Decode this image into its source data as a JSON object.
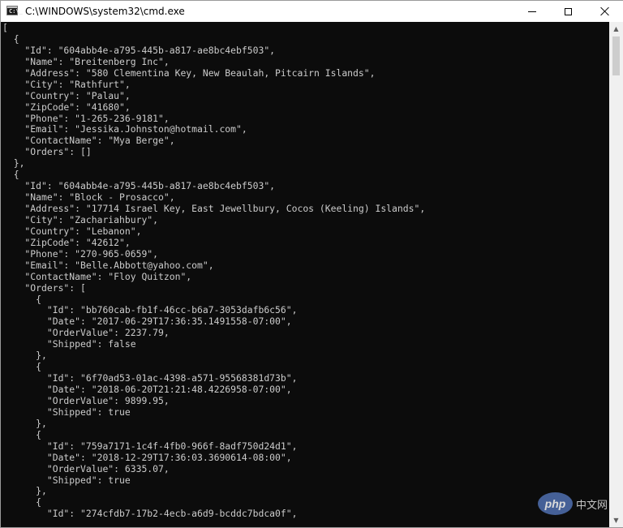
{
  "window": {
    "title": "C:\\WINDOWS\\system32\\cmd.exe",
    "app_icon": "console-icon",
    "controls": {
      "minimize_icon": "minimize-icon",
      "maximize_icon": "maximize-icon",
      "close_icon": "close-icon"
    }
  },
  "console": {
    "background": "#0c0c0c",
    "foreground": "#cccccc",
    "text": "[\n  {\n    \"Id\": \"604abb4e-a795-445b-a817-ae8bc4ebf503\",\n    \"Name\": \"Breitenberg Inc\",\n    \"Address\": \"580 Clementina Key, New Beaulah, Pitcairn Islands\",\n    \"City\": \"Rathfurt\",\n    \"Country\": \"Palau\",\n    \"ZipCode\": \"41680\",\n    \"Phone\": \"1-265-236-9181\",\n    \"Email\": \"Jessika.Johnston@hotmail.com\",\n    \"ContactName\": \"Mya Berge\",\n    \"Orders\": []\n  },\n  {\n    \"Id\": \"604abb4e-a795-445b-a817-ae8bc4ebf503\",\n    \"Name\": \"Block - Prosacco\",\n    \"Address\": \"17714 Israel Key, East Jewellbury, Cocos (Keeling) Islands\",\n    \"City\": \"Zachariahbury\",\n    \"Country\": \"Lebanon\",\n    \"ZipCode\": \"42612\",\n    \"Phone\": \"270-965-0659\",\n    \"Email\": \"Belle.Abbott@yahoo.com\",\n    \"ContactName\": \"Floy Quitzon\",\n    \"Orders\": [\n      {\n        \"Id\": \"bb760cab-fb1f-46cc-b6a7-3053dafb6c56\",\n        \"Date\": \"2017-06-29T17:36:35.1491558-07:00\",\n        \"OrderValue\": 2237.79,\n        \"Shipped\": false\n      },\n      {\n        \"Id\": \"6f70ad53-01ac-4398-a571-95568381d73b\",\n        \"Date\": \"2018-06-20T21:21:48.4226958-07:00\",\n        \"OrderValue\": 9899.95,\n        \"Shipped\": true\n      },\n      {\n        \"Id\": \"759a7171-1c4f-4fb0-966f-8adf750d24d1\",\n        \"Date\": \"2018-12-29T17:36:03.3690614-08:00\",\n        \"OrderValue\": 6335.07,\n        \"Shipped\": true\n      },\n      {\n        \"Id\": \"274cfdb7-17b2-4ecb-a6d9-bcddc7bdca0f\","
  },
  "scrollbar": {
    "up_icon": "scroll-up-arrow-icon",
    "down_icon": "scroll-down-arrow-icon"
  },
  "watermark": {
    "badge": "php",
    "text": "中文网"
  }
}
